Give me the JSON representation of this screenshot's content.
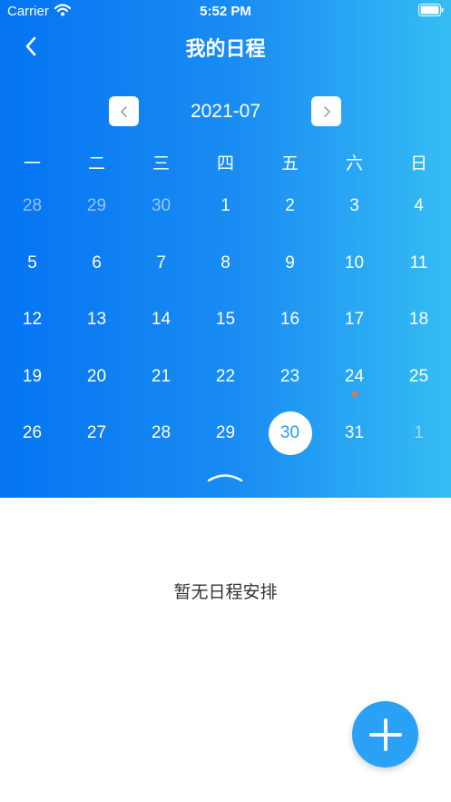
{
  "status_bar": {
    "carrier": "Carrier",
    "time": "5:52 PM"
  },
  "nav": {
    "title": "我的日程"
  },
  "calendar": {
    "month_label": "2021-07",
    "weekdays": [
      "一",
      "二",
      "三",
      "四",
      "五",
      "六",
      "日"
    ],
    "weeks": [
      [
        {
          "n": "28",
          "other": true
        },
        {
          "n": "29",
          "other": true
        },
        {
          "n": "30",
          "other": true
        },
        {
          "n": "1"
        },
        {
          "n": "2"
        },
        {
          "n": "3"
        },
        {
          "n": "4"
        }
      ],
      [
        {
          "n": "5"
        },
        {
          "n": "6"
        },
        {
          "n": "7"
        },
        {
          "n": "8"
        },
        {
          "n": "9"
        },
        {
          "n": "10"
        },
        {
          "n": "11"
        }
      ],
      [
        {
          "n": "12"
        },
        {
          "n": "13"
        },
        {
          "n": "14"
        },
        {
          "n": "15"
        },
        {
          "n": "16"
        },
        {
          "n": "17"
        },
        {
          "n": "18"
        }
      ],
      [
        {
          "n": "19"
        },
        {
          "n": "20"
        },
        {
          "n": "21"
        },
        {
          "n": "22"
        },
        {
          "n": "23"
        },
        {
          "n": "24",
          "event": true
        },
        {
          "n": "25"
        }
      ],
      [
        {
          "n": "26"
        },
        {
          "n": "27"
        },
        {
          "n": "28"
        },
        {
          "n": "29"
        },
        {
          "n": "30",
          "selected": true
        },
        {
          "n": "31"
        },
        {
          "n": "1",
          "other": true
        }
      ]
    ],
    "event_dot_color": "#f0743a"
  },
  "empty_message": "暂无日程安排",
  "colors": {
    "accent": "#2aa1f4",
    "gradient_start": "#0474f2",
    "gradient_end": "#35bdf3"
  },
  "icons": {
    "back": "chevron-left-icon",
    "prev": "chevron-left-icon",
    "next": "chevron-right-icon",
    "collapse": "chevron-up-icon",
    "add": "plus-icon"
  }
}
